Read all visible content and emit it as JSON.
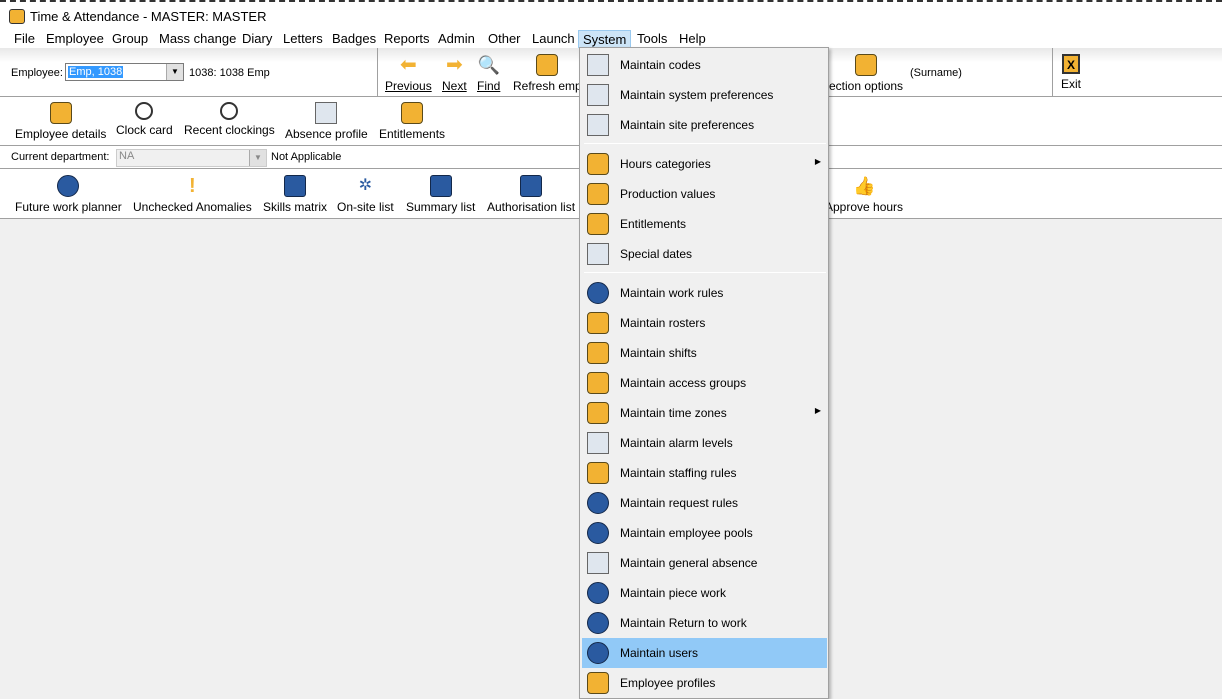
{
  "window": {
    "title": "Time & Attendance - MASTER: MASTER"
  },
  "menubar": [
    "File",
    "Employee",
    "Group",
    "Mass change",
    "Diary",
    "Letters",
    "Badges",
    "Reports",
    "Admin",
    "Other",
    "Launch",
    "System",
    "Tools",
    "Help"
  ],
  "toolbar1": {
    "employee_label": "Employee:",
    "employee_value": "Emp, 1038",
    "employee_desc": "1038:  1038 Emp",
    "previous": "Previous",
    "next": "Next",
    "find": "Find",
    "refresh": "Refresh emp",
    "selection_options": "ection options",
    "sort": "(Surname)",
    "exit": "Exit"
  },
  "toolbar2": [
    "Employee details",
    "Clock card",
    "Recent clockings",
    "Absence profile",
    "Entitlements"
  ],
  "department": {
    "label": "Current department:",
    "value": "NA",
    "desc": "Not Applicable"
  },
  "toolbar4": [
    "Future work planner",
    "Unchecked Anomalies",
    "Skills matrix",
    "On-site list",
    "Summary list",
    "Authorisation list",
    "Approve hours"
  ],
  "system_menu": [
    {
      "label": "Maintain codes",
      "icon": "codes-icon"
    },
    {
      "label": "Maintain system preferences",
      "icon": "system-preferences-icon"
    },
    {
      "label": "Maintain site preferences",
      "icon": "site-preferences-icon"
    },
    {
      "label": "Hours categories",
      "icon": "hours-categories-icon",
      "submenu": true
    },
    {
      "label": "Production values",
      "icon": "production-values-icon"
    },
    {
      "label": "Entitlements",
      "icon": "entitlements-icon"
    },
    {
      "label": "Special dates",
      "icon": "special-dates-icon"
    },
    {
      "label": "Maintain work rules",
      "icon": "work-rules-icon"
    },
    {
      "label": "Maintain rosters",
      "icon": "rosters-icon"
    },
    {
      "label": "Maintain shifts",
      "icon": "shifts-icon"
    },
    {
      "label": "Maintain access groups",
      "icon": "access-groups-icon"
    },
    {
      "label": "Maintain time zones",
      "icon": "time-zones-icon",
      "submenu": true
    },
    {
      "label": "Maintain alarm levels",
      "icon": "alarm-levels-icon"
    },
    {
      "label": "Maintain staffing rules",
      "icon": "staffing-rules-icon"
    },
    {
      "label": "Maintain request rules",
      "icon": "request-rules-icon"
    },
    {
      "label": "Maintain employee pools",
      "icon": "employee-pools-icon"
    },
    {
      "label": "Maintain general absence",
      "icon": "general-absence-icon"
    },
    {
      "label": "Maintain piece work",
      "icon": "piece-work-icon"
    },
    {
      "label": "Maintain Return to work",
      "icon": "return-to-work-icon"
    },
    {
      "label": "Maintain users",
      "icon": "users-icon",
      "highlighted": true
    },
    {
      "label": "Employee profiles",
      "icon": "employee-profiles-icon"
    }
  ]
}
